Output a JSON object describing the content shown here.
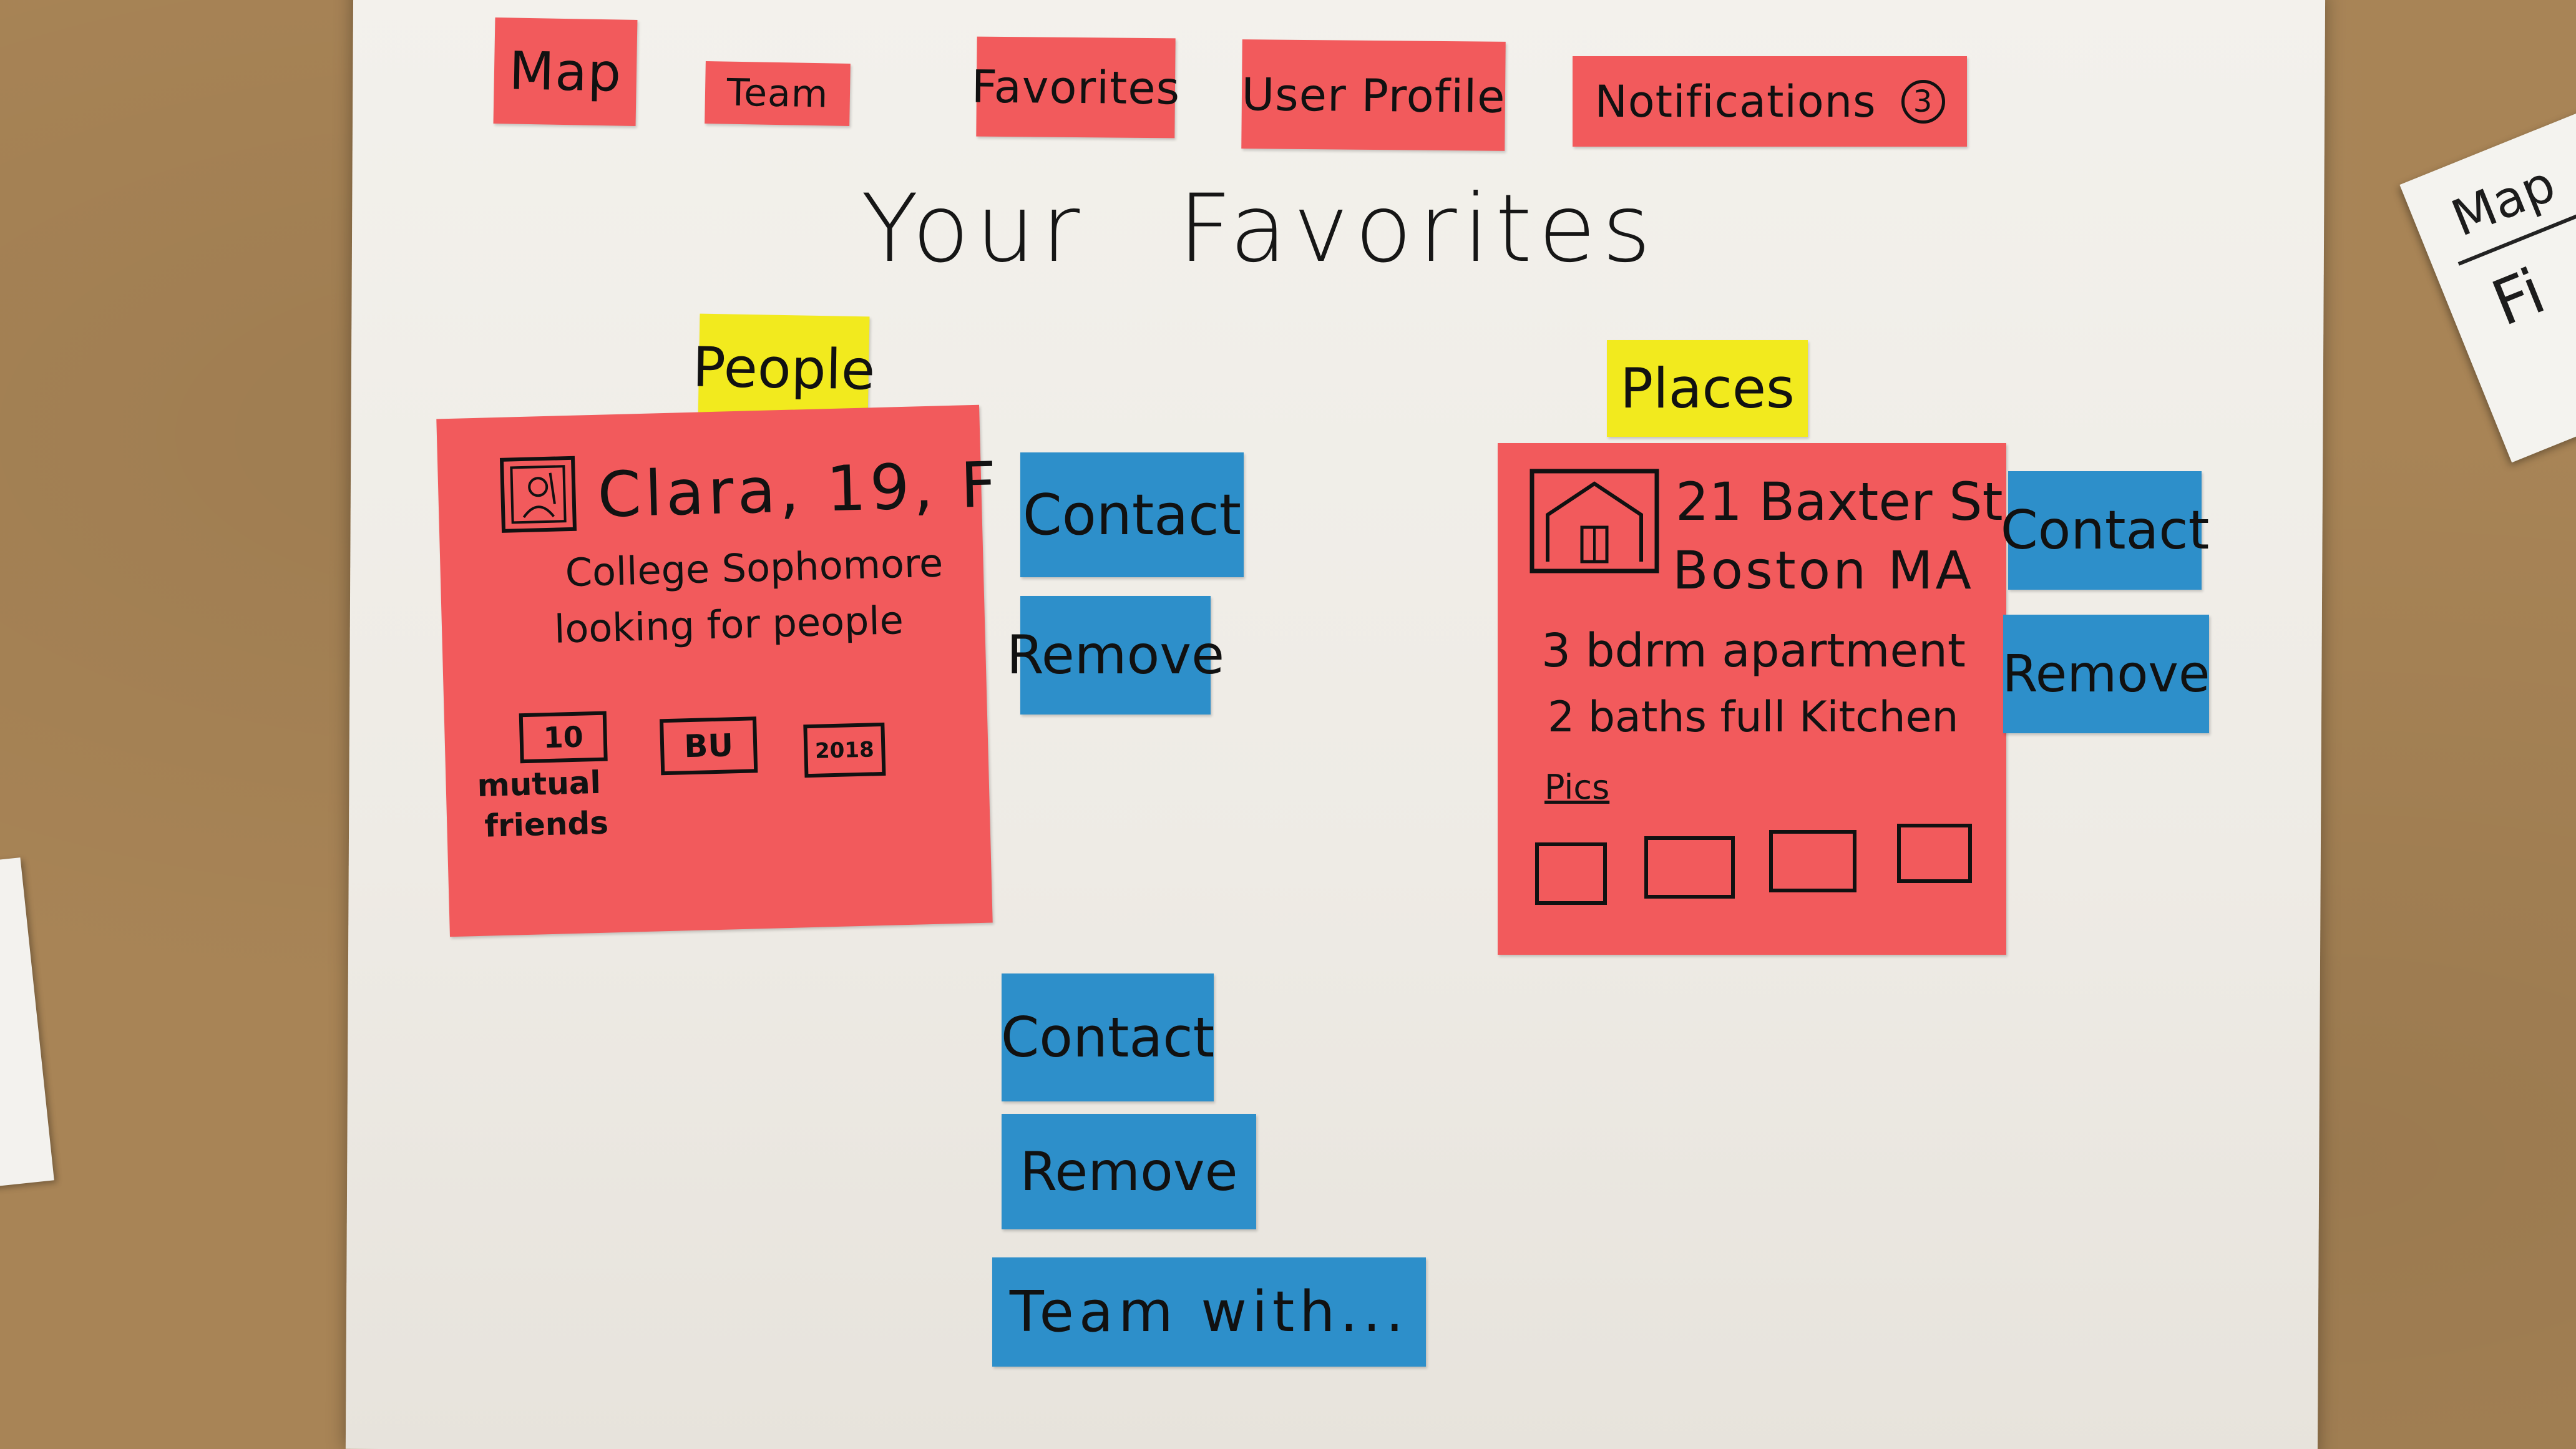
{
  "nav": {
    "map": "Map",
    "team": "Team",
    "favorites": "Favorites",
    "user_profile": "User Profile",
    "notifications": "Notifications",
    "notifications_count": "3"
  },
  "page_title": "Your Favorites",
  "people": {
    "label": "People",
    "card": {
      "name_line": "Clara, 19, F",
      "desc_line1": "College Sophomore",
      "desc_line2": "looking for people",
      "mutual_count": "10",
      "school": "BU",
      "year": "2018",
      "mutual_label_line1": "mutual",
      "mutual_label_line2": "friends"
    },
    "contact_label": "Contact",
    "remove_label": "Remove"
  },
  "places": {
    "label": "Places",
    "card": {
      "address_line1": "21 Baxter St,",
      "address_line2": "Boston MA",
      "detail_line1": "3 bdrm apartment",
      "detail_line2": "2 baths full Kitchen",
      "pics_label": "Pics"
    },
    "contact_label": "Contact",
    "remove_label": "Remove"
  },
  "bottom_actions": {
    "contact_label": "Contact",
    "remove_label": "Remove",
    "team_with_label": "Team with..."
  },
  "side_card_right": {
    "line1": "Map",
    "line2": "Fi"
  },
  "colors": {
    "red_note": "#f25a5c",
    "blue_note": "#2d8fca",
    "yellow_note": "#f2ea1e",
    "paper": "#f3f1ec",
    "table": "#a88456"
  },
  "icons": {
    "person_photo": "person-portrait-icon",
    "house": "house-icon"
  }
}
